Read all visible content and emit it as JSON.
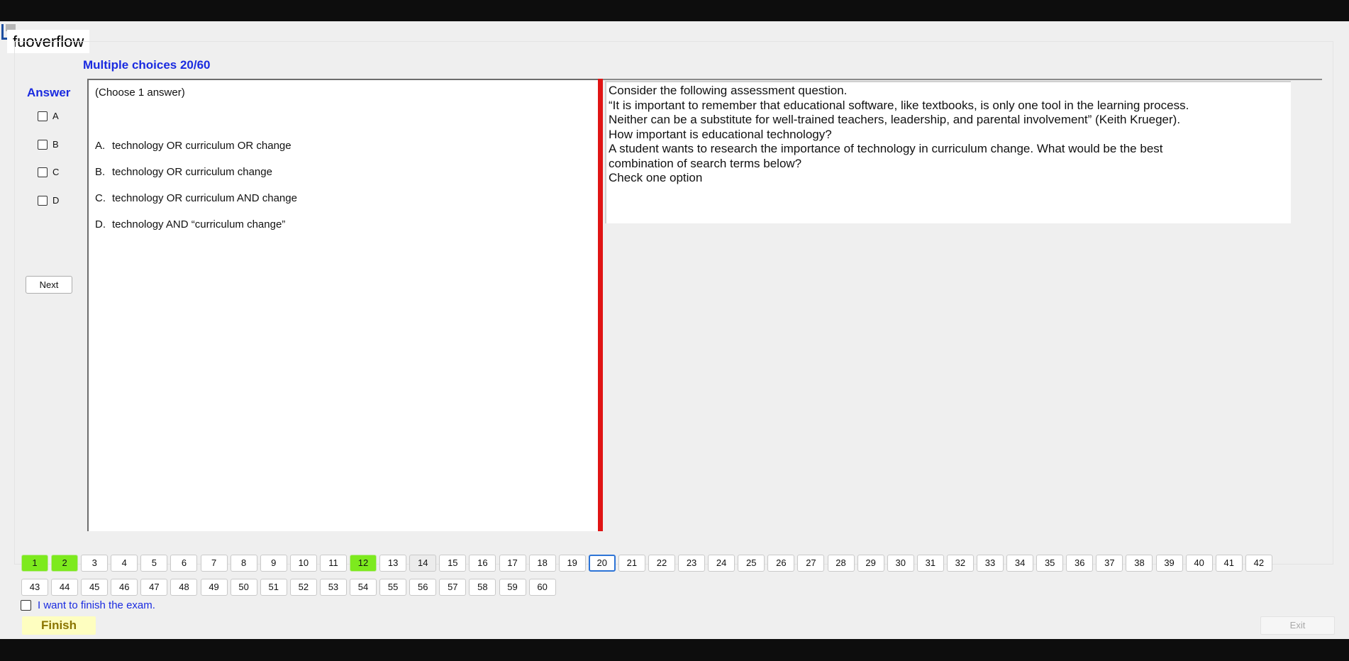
{
  "app": {
    "title": "fuoverflow"
  },
  "exam": {
    "section_title": "Multiple choices 20/60",
    "answer_label": "Answer",
    "answer_choices": [
      "A",
      "B",
      "C",
      "D"
    ],
    "next_label": "Next",
    "instruction": "(Choose 1 answer)",
    "options": [
      {
        "key": "A.",
        "text": "technology OR curriculum OR change"
      },
      {
        "key": "B.",
        "text": "technology OR curriculum change"
      },
      {
        "key": "C.",
        "text": "technology OR curriculum AND change"
      },
      {
        "key": "D.",
        "text": "technology AND “curriculum change”"
      }
    ],
    "question_lines": [
      "Consider the following assessment question.",
      "“It is important to remember that educational software, like textbooks, is only one tool in the learning process.",
      "Neither can be a substitute for well-trained teachers, leadership, and parental involvement” (Keith Krueger).",
      "How important is educational technology?",
      "A student wants to research the importance of technology in curriculum change. What would be the best",
      "combination of search terms below?",
      "Check one option"
    ]
  },
  "navigator": {
    "current": 20,
    "answered": [
      1,
      2,
      12
    ],
    "visited": [
      14
    ],
    "row1": [
      1,
      2,
      3,
      4,
      5,
      6,
      7,
      8,
      9,
      10,
      11,
      12,
      13,
      14,
      15,
      16,
      17,
      18,
      19,
      20,
      21,
      22,
      23,
      24,
      25,
      26,
      27,
      28,
      29,
      30,
      31,
      32,
      33,
      34,
      35,
      36,
      37,
      38,
      39,
      40,
      41,
      42
    ],
    "row2": [
      43,
      44,
      45,
      46,
      47,
      48,
      49,
      50,
      51,
      52,
      53,
      54,
      55,
      56,
      57,
      58,
      59,
      60
    ]
  },
  "footer": {
    "finish_checkbox_label": "I want to finish the exam.",
    "finish_label": "Finish",
    "exit_label": "Exit"
  },
  "colors": {
    "accent_blue": "#1a2be0",
    "answered_green": "#7dea1e",
    "divider_red": "#e01414",
    "finish_yellow": "#fefec0"
  }
}
